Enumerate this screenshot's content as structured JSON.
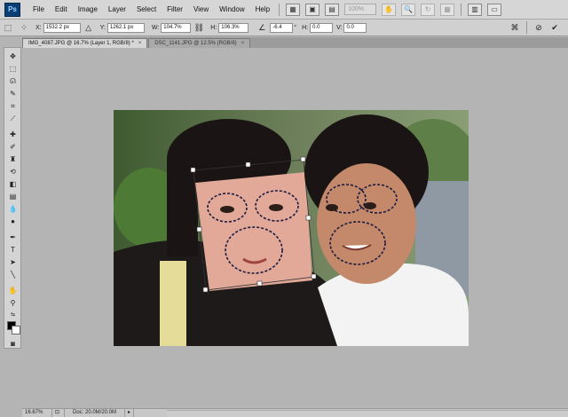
{
  "menu": {
    "logo": "Ps",
    "items": [
      "File",
      "Edit",
      "Image",
      "Layer",
      "Select",
      "Filter",
      "View",
      "Window",
      "Help"
    ],
    "zoom": "100%"
  },
  "options": {
    "x_label": "X:",
    "x_value": "1532.2 px",
    "y_label": "Y:",
    "y_value": "1262.1 px",
    "w_label": "W:",
    "w_value": "104.7%",
    "h_label": "H:",
    "h_value": "106.3%",
    "angle_value": "-6.4",
    "angle_unit": "°",
    "hskew_label": "H:",
    "hskew_value": "0.0",
    "vskew_label": "V:",
    "vskew_value": "0.0"
  },
  "tabs": [
    {
      "label": "IMG_4087.JPG @ 16.7% (Layer 1, RGB/8) *",
      "close": "×"
    },
    {
      "label": "DSC_1141.JPG @ 12.5% (RGB/8)",
      "close": "×"
    }
  ],
  "status": {
    "zoom": "16.67%",
    "doc": "Doc: 20.0M/20.0M"
  },
  "icons": {
    "logo": "photoshop-logo",
    "commit": "checkmark-icon",
    "cancel": "cancel-icon",
    "warp": "warp-icon"
  },
  "colors": {
    "foreground": "#000000",
    "background": "#ffffff",
    "accent": "#0c3e76"
  }
}
